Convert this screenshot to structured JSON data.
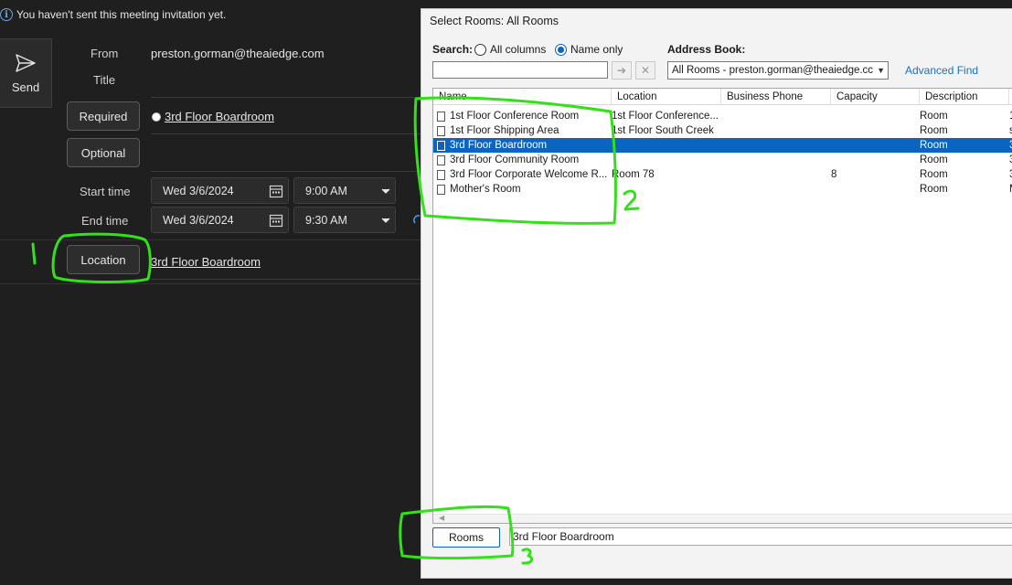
{
  "infobar": {
    "text": "You haven't sent this meeting invitation yet."
  },
  "send": {
    "label": "Send"
  },
  "meeting": {
    "from_label": "From",
    "from_value": "preston.gorman@theaiedge.com",
    "title_label": "Title",
    "required_label": "Required",
    "required_attendee": "3rd Floor Boardroom",
    "optional_label": "Optional",
    "start_label": "Start time",
    "start_date": "Wed 3/6/2024",
    "start_time": "9:00 AM",
    "end_label": "End time",
    "end_date": "Wed 3/6/2024",
    "end_time": "9:30 AM",
    "location_label": "Location",
    "location_value": "3rd Floor Boardroom"
  },
  "dialog": {
    "title": "Select Rooms: All Rooms",
    "search_label": "Search:",
    "radio_all": "All columns",
    "radio_name": "Name only",
    "address_book_label": "Address Book:",
    "address_book_value": "All Rooms - preston.gorman@theaiedge.cc",
    "advanced_find": "Advanced Find",
    "columns": [
      "Name",
      "Location",
      "Business Phone",
      "Capacity",
      "Description"
    ],
    "rows": [
      {
        "name": "1st Floor Conference Room",
        "location": "1st Floor Conference...",
        "phone": "",
        "capacity": "",
        "description": "Room",
        "extra": "1"
      },
      {
        "name": "1st Floor Shipping Area",
        "location": "1st Floor South Creek",
        "phone": "",
        "capacity": "",
        "description": "Room",
        "extra": "s"
      },
      {
        "name": "3rd Floor Boardroom",
        "location": "",
        "phone": "",
        "capacity": "",
        "description": "Room",
        "extra": "3"
      },
      {
        "name": "3rd Floor Community Room",
        "location": "",
        "phone": "",
        "capacity": "",
        "description": "Room",
        "extra": "3"
      },
      {
        "name": "3rd Floor Corporate Welcome R...",
        "location": "Room 78",
        "phone": "",
        "capacity": "8",
        "description": "Room",
        "extra": "3"
      },
      {
        "name": "Mother's Room",
        "location": "",
        "phone": "",
        "capacity": "",
        "description": "Room",
        "extra": "M"
      }
    ],
    "selected_row": 2,
    "rooms_button": "Rooms",
    "rooms_value": "3rd Floor Boardroom"
  },
  "annotations": {
    "mark_1": "1",
    "mark_2": "2",
    "mark_3": "3",
    "color": "#33e01a"
  }
}
